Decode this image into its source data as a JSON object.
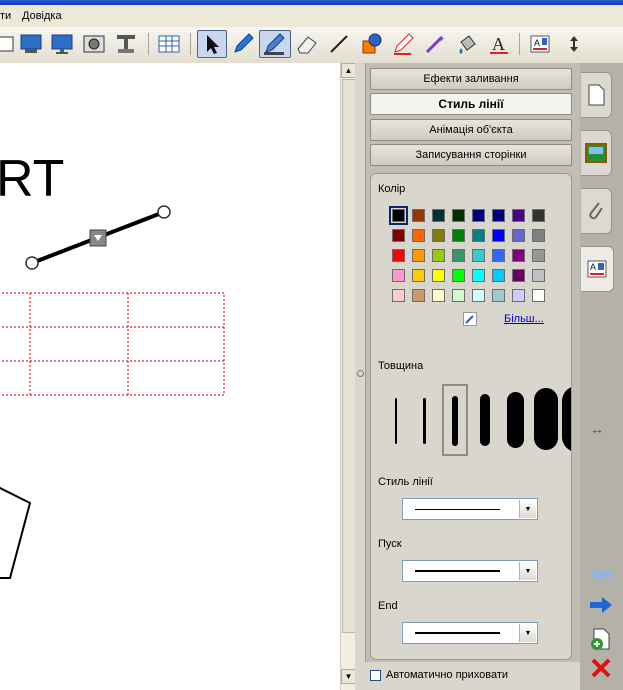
{
  "menu": {
    "item_1": "ти",
    "item_2": "Довідка",
    "item_2_accesskey": "Д"
  },
  "canvas": {
    "text_fragment": "RT"
  },
  "panel": {
    "tabs": [
      "Ефекти заливання",
      "Стиль лінії",
      "Анімація об'єкта",
      "Записування сторінки"
    ],
    "selected_tab": "Стиль лінії",
    "color_label": "Колір",
    "more_link": "Більш...",
    "thickness_label": "Товщина",
    "line_style_label": "Стиль лінії",
    "start_label": "Пуск",
    "end_label": "End",
    "auto_hide_label": "Автоматично приховати",
    "auto_hide_checked": false,
    "palette": [
      "#000000",
      "#993300",
      "#003333",
      "#003300",
      "#000080",
      "#000080",
      "#4b0082",
      "#333333",
      "#800000",
      "#ff6600",
      "#808000",
      "#008000",
      "#008080",
      "#0000ff",
      "#6666cc",
      "#808080",
      "#ff0000",
      "#ff9900",
      "#99cc00",
      "#339966",
      "#33cccc",
      "#3366ff",
      "#800080",
      "#969696",
      "#ff99cc",
      "#ffcc00",
      "#ffff00",
      "#00ff00",
      "#00ffff",
      "#00ccff",
      "#660066",
      "#c0c0c0",
      "#ffcccc",
      "#cc9966",
      "#ffffcc",
      "#ccffcc",
      "#ccffff",
      "#99cccc",
      "#ccccff",
      "#ffffff"
    ],
    "selected_color": "#000000"
  },
  "toolbar": {
    "icons": [
      "slide-icon",
      "monitor-icon",
      "screen-show-icon",
      "camera-icon",
      "document-camera-icon",
      "table-icon",
      "select-arrow-icon",
      "pen-icon",
      "highlighter-icon",
      "eraser-icon",
      "line-icon",
      "shapes-icon",
      "magic-pen-icon",
      "wand-icon",
      "fill-icon",
      "text-icon",
      "properties-icon",
      "updown-icon"
    ]
  }
}
